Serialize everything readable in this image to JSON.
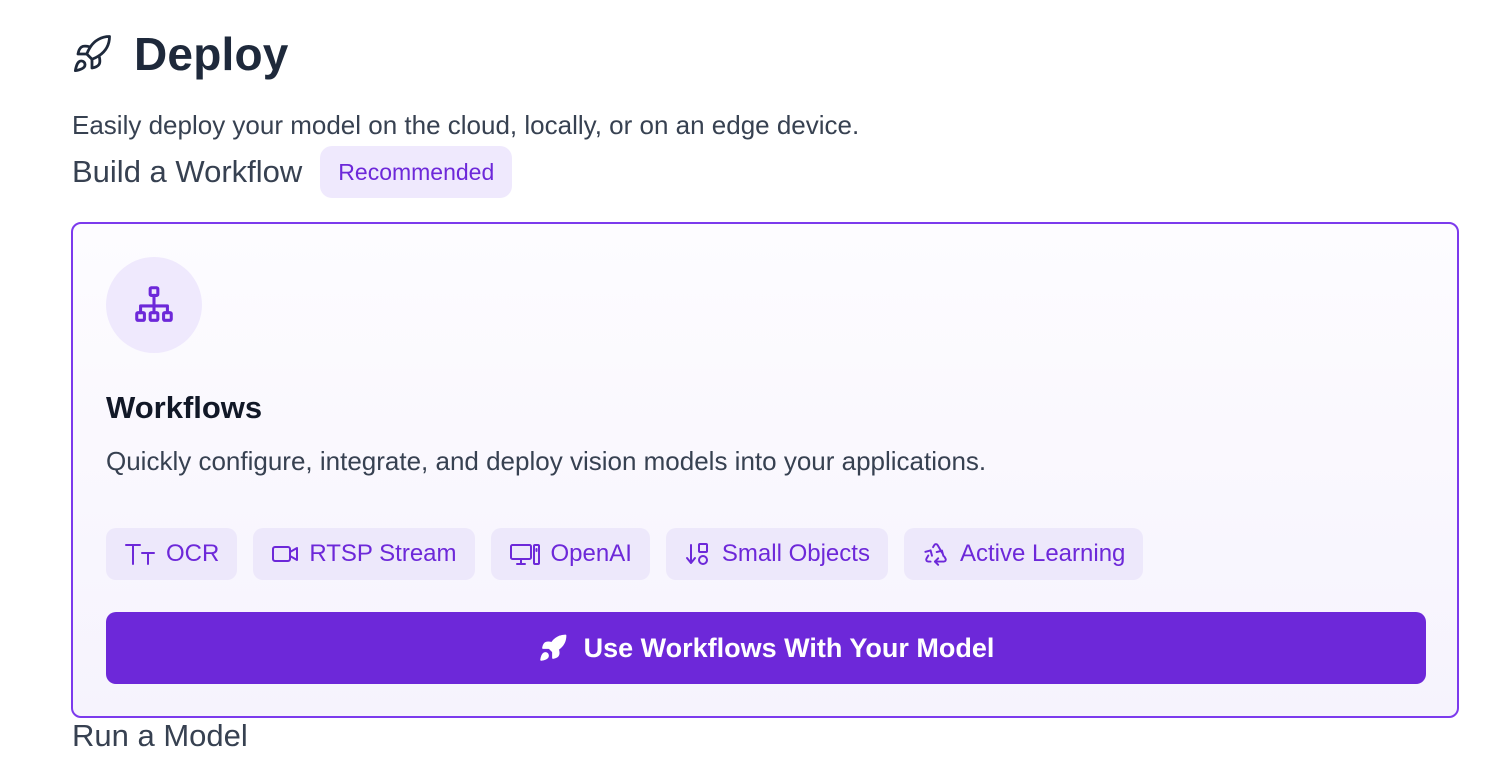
{
  "header": {
    "title": "Deploy",
    "icon": "rocket-icon"
  },
  "subtitle": "Easily deploy your model on the cloud, locally, or on an edge device.",
  "build_section": {
    "title": "Build a Workflow",
    "badge": "Recommended"
  },
  "workflow_card": {
    "icon": "workflow-hierarchy-icon",
    "title": "Workflows",
    "description": "Quickly configure, integrate, and deploy vision models into your applications.",
    "chips": [
      {
        "label": "OCR",
        "icon": "text-size-icon"
      },
      {
        "label": "RTSP Stream",
        "icon": "video-camera-icon"
      },
      {
        "label": "OpenAI",
        "icon": "desktop-computer-icon"
      },
      {
        "label": "Small Objects",
        "icon": "sort-shapes-icon"
      },
      {
        "label": "Active Learning",
        "icon": "recycle-icon"
      }
    ],
    "cta_label": "Use Workflows With Your Model"
  },
  "run_section": {
    "title": "Run a Model"
  },
  "colors": {
    "accent": "#6d28d9",
    "accent_light": "#efe9fd",
    "border": "#7c3aed",
    "text_dark": "#1e293b",
    "text_body": "#374151"
  }
}
